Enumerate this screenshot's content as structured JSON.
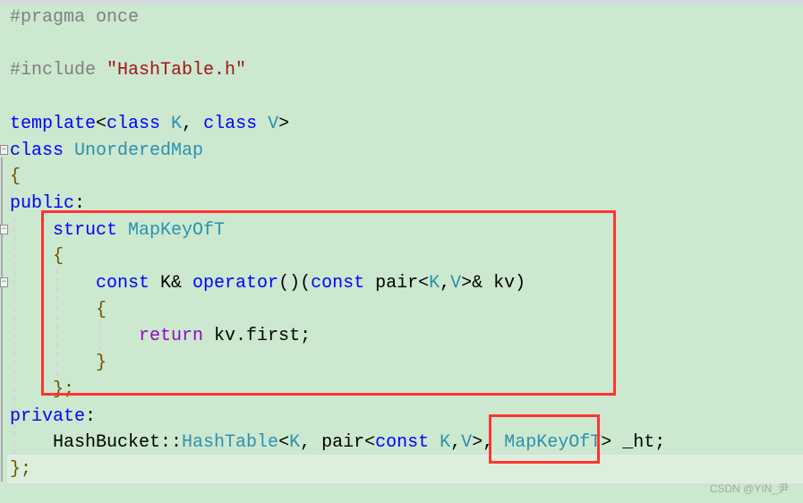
{
  "editor": {
    "colors": {
      "background": "#cce8cf",
      "keyword": "#0000ff",
      "type": "#2b91af",
      "preprocessor": "#808080",
      "string": "#a31515",
      "control": "#8f08c4",
      "highlight_box": "#ff3333"
    },
    "lines": [
      [
        [
          "#pragma once",
          "pp"
        ]
      ],
      [],
      [
        [
          "#include ",
          "pp"
        ],
        [
          "\"HashTable.h\"",
          "st"
        ]
      ],
      [],
      [
        [
          "template",
          "kw"
        ],
        [
          "<",
          "tx"
        ],
        [
          "class",
          "kw"
        ],
        [
          " K",
          "ty"
        ],
        [
          ", ",
          "tx"
        ],
        [
          "class",
          "kw"
        ],
        [
          " V",
          "ty"
        ],
        [
          ">",
          "tx"
        ]
      ],
      [
        [
          "class",
          "kw"
        ],
        [
          " UnorderedMap",
          "ty"
        ]
      ],
      [
        [
          "{",
          "br"
        ]
      ],
      [
        [
          "public",
          "kw"
        ],
        [
          ":",
          "tx"
        ]
      ],
      [
        [
          "    ",
          "tx"
        ],
        [
          "struct",
          "kw"
        ],
        [
          " MapKeyOfT",
          "ty"
        ]
      ],
      [
        [
          "    {",
          "br"
        ]
      ],
      [
        [
          "        ",
          "tx"
        ],
        [
          "const",
          "kw"
        ],
        [
          " K& ",
          "tx"
        ],
        [
          "operator",
          "kw"
        ],
        [
          "()(",
          "tx"
        ],
        [
          "const",
          "kw"
        ],
        [
          " pair<",
          "tx"
        ],
        [
          "K",
          "ty"
        ],
        [
          ",",
          "tx"
        ],
        [
          "V",
          "ty"
        ],
        [
          ">& kv)",
          "tx"
        ]
      ],
      [
        [
          "        {",
          "br"
        ]
      ],
      [
        [
          "            ",
          "tx"
        ],
        [
          "return",
          "rt"
        ],
        [
          " kv.first;",
          "tx"
        ]
      ],
      [
        [
          "        }",
          "br"
        ]
      ],
      [
        [
          "    };",
          "br"
        ]
      ],
      [
        [
          "private",
          "kw"
        ],
        [
          ":",
          "tx"
        ]
      ],
      [
        [
          "    HashBucket::",
          "tx"
        ],
        [
          "HashTable",
          "ty"
        ],
        [
          "<",
          "tx"
        ],
        [
          "K",
          "ty"
        ],
        [
          ", pair<",
          "tx"
        ],
        [
          "const",
          "kw"
        ],
        [
          " ",
          "tx"
        ],
        [
          "K",
          "ty"
        ],
        [
          ",",
          "tx"
        ],
        [
          "V",
          "ty"
        ],
        [
          ">, ",
          "tx"
        ],
        [
          "MapKeyOfT",
          "ty"
        ],
        [
          "> _ht;",
          "tx"
        ]
      ],
      [
        [
          "};",
          "br"
        ]
      ]
    ]
  },
  "watermark": "CSDN @YIN_尹"
}
